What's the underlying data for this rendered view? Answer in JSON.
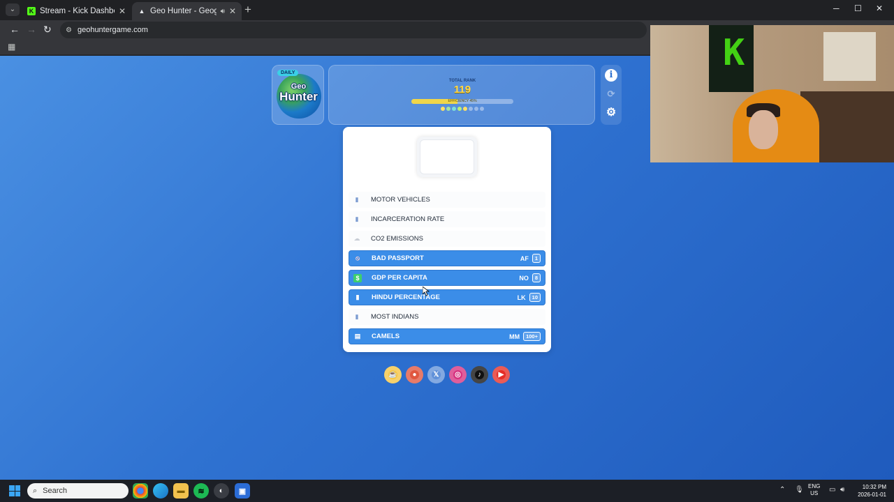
{
  "browser": {
    "tabs": [
      {
        "title": "Stream - Kick Dashboard",
        "active": false
      },
      {
        "title": "Geo Hunter - Geography Q",
        "active": true
      }
    ],
    "url": "geohuntergame.com"
  },
  "game": {
    "logo": {
      "badge": "DAILY",
      "line1": "Geo",
      "line2": "Hunter"
    },
    "rank": {
      "label": "TOTAL RANK",
      "value": "119",
      "efficiency_label": "EFFICIENCY 45%",
      "efficiency": 0.45
    },
    "progress_dots": [
      "#ffe066",
      "#a6e3a1",
      "#7ee0d8",
      "#b7f07a",
      "#ffe066",
      "rgba(255,255,255,0.4)",
      "rgba(255,255,255,0.4)",
      "rgba(255,255,255,0.4)"
    ],
    "categories": [
      {
        "label": "MOTOR VEHICLES",
        "state": "plain",
        "icon": "bar-chart-icon"
      },
      {
        "label": "INCARCERATION RATE",
        "state": "plain",
        "icon": "bar-chart-icon"
      },
      {
        "label": "CO2 EMISSIONS",
        "state": "plain",
        "icon": "cloud-icon"
      },
      {
        "label": "BAD PASSPORT",
        "state": "done",
        "code": "AF",
        "rank": "1",
        "icon": "no-entry-icon"
      },
      {
        "label": "GDP PER CAPITA",
        "state": "done",
        "code": "NO",
        "rank": "8",
        "icon": "money-icon"
      },
      {
        "label": "HINDU PERCENTAGE",
        "state": "done",
        "code": "LK",
        "rank": "10",
        "icon": "bar-chart-icon"
      },
      {
        "label": "MOST INDIANS",
        "state": "plain",
        "icon": "bar-chart-icon"
      },
      {
        "label": "CAMELS",
        "state": "done",
        "code": "MM",
        "rank": "100+",
        "icon": "camel-icon"
      }
    ],
    "socials": [
      "coffee-icon",
      "patreon-icon",
      "x-icon",
      "instagram-icon",
      "tiktok-icon",
      "youtube-icon"
    ],
    "social_glyphs": [
      "☕",
      "●",
      "𝕏",
      "◎",
      "♪",
      "▶"
    ]
  },
  "taskbar": {
    "search_placeholder": "Search",
    "lang": "ENG",
    "region": "US",
    "time": "10:32 PM",
    "date": "2026-01-01"
  }
}
